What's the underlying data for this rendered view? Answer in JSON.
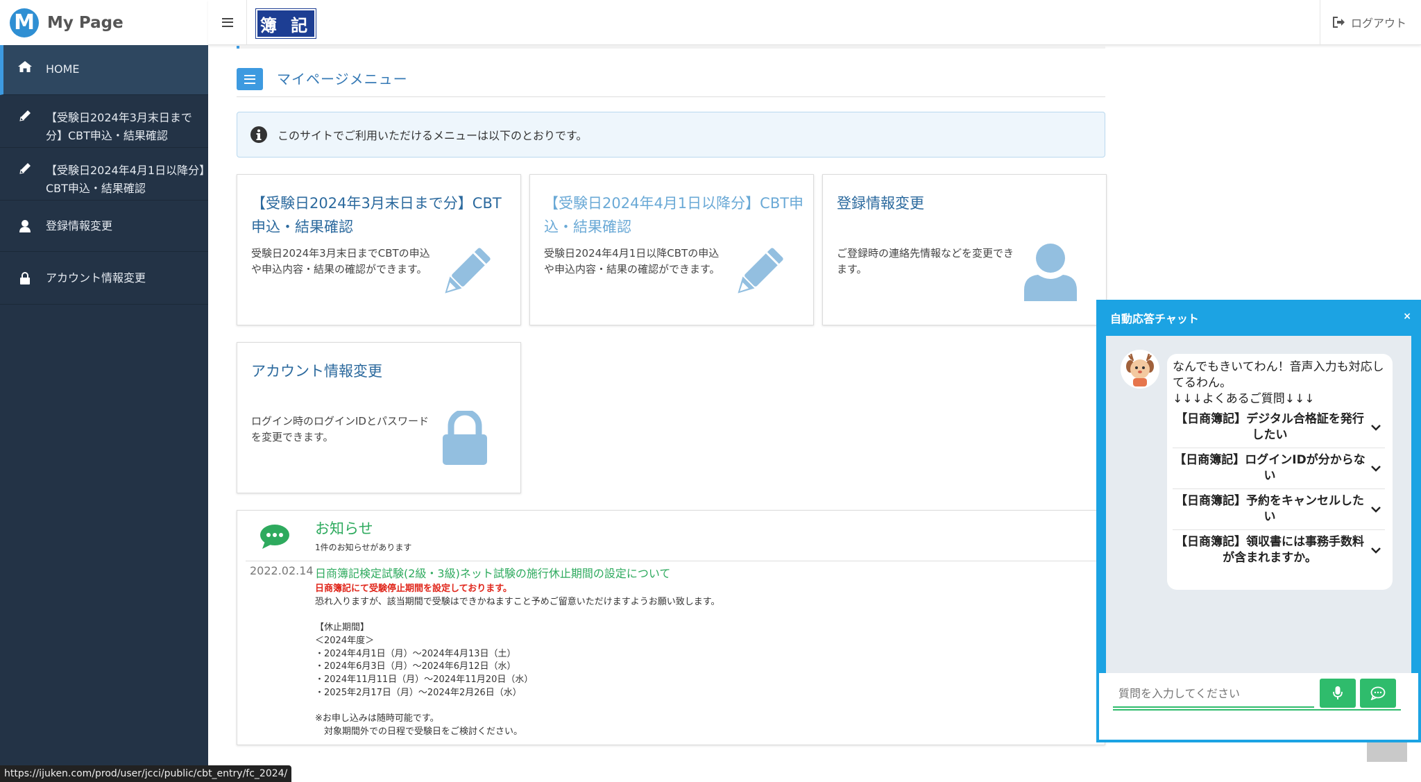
{
  "brand": {
    "logo_letter": "M",
    "title": "My Page"
  },
  "header": {
    "badge": "簿 記",
    "logout": "ログアウト"
  },
  "sidebar": {
    "items": [
      {
        "label": "HOME",
        "icon": "home-icon",
        "active": true
      },
      {
        "label": "【受験日2024年3月末日まで分】CBT申込・結果確認",
        "icon": "pencil-icon"
      },
      {
        "label": "【受験日2024年4月1日以降分】CBT申込・結果確認",
        "icon": "pencil-icon"
      },
      {
        "label": "登録情報変更",
        "icon": "user-icon"
      },
      {
        "label": "アカウント情報変更",
        "icon": "lock-icon"
      }
    ]
  },
  "main": {
    "section_title": "マイページメニュー",
    "info": "このサイトでご利用いただけるメニューは以下のとおりです。",
    "cards": [
      {
        "title": "【受験日2024年3月末日まで分】CBT申込・結果確認",
        "desc": "受験日2024年3月末日までCBTの申込や申込内容・結果の確認ができます。",
        "icon": "pencil-icon"
      },
      {
        "title": "【受験日2024年4月1日以降分】CBT申込・結果確認",
        "desc": "受験日2024年4月1日以降CBTの申込や申込内容・結果の確認ができます。",
        "icon": "pencil-icon"
      },
      {
        "title": "登録情報変更",
        "desc": "ご登録時の連絡先情報などを変更できます。",
        "icon": "user-icon"
      },
      {
        "title": "アカウント情報変更",
        "desc": "ログイン時のログインIDとパスワードを変更できます。",
        "icon": "lock-icon"
      }
    ]
  },
  "news": {
    "title": "お知らせ",
    "count": "1件のお知らせがあります",
    "date": "2022.02.14",
    "headline": "日商簿記検定試験(2級・3級)ネット試験の施行休止期間の設定について",
    "warning": "日商簿記にて受験停止期間を設定しております。",
    "body": "恐れ入りますが、該当期間で受験はできかねますこと予めご留意いただけますようお願い致します。\n\n【休止期間】\n＜2024年度＞\n・2024年4月1日（月）〜2024年4月13日（土）\n・2024年6月3日（月）〜2024年6月12日（水）\n・2024年11月11日（月）〜2024年11月20日（水）\n・2025年2月17日（月）〜2024年2月26日（水）\n\n※お申し込みは随時可能です。\n　対象期間外での日程で受験日をご検討ください。"
  },
  "chat": {
    "title": "自動応答チャット",
    "close": "×",
    "greeting": "なんでもきいてわん！音声入力も対応してるわん。",
    "faq_header": "↓↓↓よくあるご質問↓↓↓",
    "faqs": [
      "【日商簿記】デジタル合格証を発行したい",
      "【日商簿記】ログインIDが分からない",
      "【日商簿記】予約をキャンセルしたい",
      "【日商簿記】領収書には事務手数料が含まれますか。"
    ],
    "input_placeholder": "質問を入力してください"
  },
  "status_url": "https://ijuken.com/prod/user/jcci/public/cbt_entry/fc_2024/",
  "colors": {
    "sidebar": "#233346",
    "accent": "#3d9ae0",
    "chat": "#1ca3e3",
    "green": "#2fbc6c",
    "badge": "#1d3e93"
  }
}
